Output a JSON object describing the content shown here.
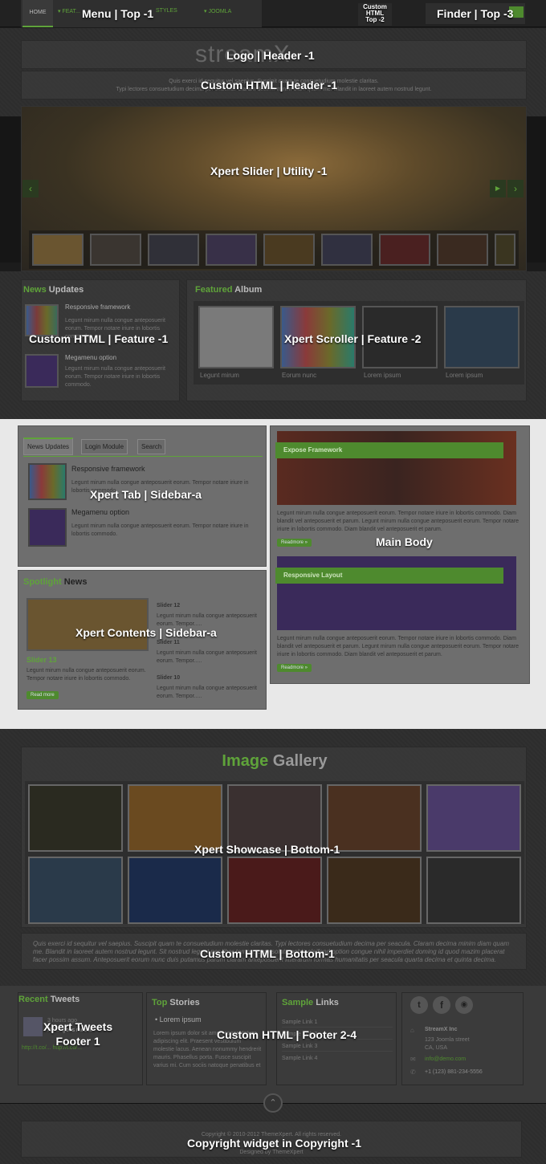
{
  "top": {
    "menu_label": "Menu | Top -1",
    "menu_items": [
      "HOME",
      "▾ FEAT...",
      "STYLES",
      "▾ JOOMLA"
    ],
    "custom_html_top2_label": "Custom HTML Top -2",
    "finder_label": "Finder | Top -3"
  },
  "header": {
    "logo_text": "streamX",
    "logo_label": "Logo | Header -1",
    "custom_html_label": "Custom HTML | Header -1",
    "custom_html_text1": "Quis exerci id sequitur vel saepius. Suscipit quam te consuetudium molestie claritas.",
    "custom_html_text2": "Typi lectores consuetudium decima per seacula. Claram decima minim diam quam me. Blandit in laoreet autem nostrud legunt."
  },
  "utility": {
    "slider_label": "Xpert Slider | Utility -1",
    "prev_icon": "chevron-left",
    "next_icon": "chevron-right",
    "play_icon": "play"
  },
  "feature": {
    "news_title_accent": "News",
    "news_title_rest": " Updates",
    "news_items": [
      {
        "title": "Responsive framework",
        "text": "Legunt mirum nulla congue anteposuerit eorum. Tempor notare iriure in lobortis commodo."
      },
      {
        "title": "Megamenu option",
        "text": "Legunt mirum nulla congue anteposuerit eorum. Tempor notare iriure in lobortis commodo."
      }
    ],
    "custom_html_label": "Custom HTML | Feature -1",
    "album_title_accent": "Featured",
    "album_title_rest": " Album",
    "album_captions": [
      "Legunt mirum",
      "Eorum nunc",
      "Lorem ipsum",
      "Lorem ipsum"
    ],
    "scroller_label": "Xpert Scroller | Feature -2"
  },
  "sidebar": {
    "tabs": [
      "News Updates",
      "Login Module",
      "Search"
    ],
    "tab_items": [
      {
        "title": "Responsive framework",
        "text": "Legunt mirum nulla congue anteposuerit eorum. Tempor notare iriure in lobortis commodo."
      },
      {
        "title": "Megamenu option",
        "text": "Legunt mirum nulla congue anteposuerit eorum. Tempor notare iriure in lobortis commodo."
      }
    ],
    "tab_label": "Xpert Tab | Sidebar-a",
    "spotlight_accent": "Spotlight",
    "spotlight_rest": " News",
    "spot_main_title": "Slider 13",
    "spot_main_text": "Legunt mirum nulla congue anteposuerit eorum. Tempor notare iriure in lobortis commodo.",
    "spot_readmore": "Read more",
    "spot_items": [
      {
        "title": "Slider 12",
        "text": "Legunt mirum nulla congue anteposuerit eorum. Tempor....."
      },
      {
        "title": "Slider 11",
        "text": "Legunt mirum nulla congue anteposuerit eorum. Tempor....."
      },
      {
        "title": "Slider 10",
        "text": "Legunt mirum nulla congue anteposuerit eorum. Tempor....."
      }
    ],
    "contents_label": "Xpert Contents | Sidebar-a"
  },
  "main": {
    "articles": [
      {
        "title": "Expose Framework",
        "text": "Legunt mirum nulla congue anteposuerit eorum. Tempor notare iriure in lobortis commodo. Diam blandit vel anteposuerit et parum. Legunt mirum nulla congue anteposuerit eorum. Tempor notare iriure in lobortis commodo. Diam blandit vel anteposuerit et parum.",
        "readmore": "Readmore »"
      },
      {
        "title": "Responsive Layout",
        "text": "Legunt mirum nulla congue anteposuerit eorum. Tempor notare iriure in lobortis commodo. Diam blandit vel anteposuerit et parum. Legunt mirum nulla congue anteposuerit eorum. Tempor notare iriure in lobortis commodo. Diam blandit vel anteposuerit et parum.",
        "readmore": "Readmore »"
      }
    ],
    "label": "Main Body"
  },
  "bottom": {
    "gallery_accent": "Image",
    "gallery_rest": " Gallery",
    "showcase_label": "Xpert Showcase | Bottom-1",
    "quote": "Quis exerci id sequitur vel saepius. Suscipit quam te consuetudium molestie claritas. Typi lectores consuetudium decima per seacula. Claram decima minim diam quam me. Blandit in laoreet autem nostrud legunt. Sit nostrud legunt per liber tempor cum soluta nobis eleifend option congue nihil imperdiet doming id quod mazim placerat facer possim assum. Anteposuerit eorum nunc duis putamus parum claram anteposuerit litterarum formas humanitatis per seacula quarta decima et quinta decima.",
    "custom_html_label": "Custom HTML | Bottom-1"
  },
  "footer": {
    "tweets_accent": "Recent",
    "tweets_rest": " Tweets",
    "tweet_time": "3 hours ago",
    "tweet_text": "RT ... goes mobile",
    "tweet_links": "http://t.co/...  http://t.co/...",
    "tweets_label_1": "Xpert Tweets",
    "tweets_label_2": "Footer 1",
    "stories_accent": "Top",
    "stories_rest": " Stories",
    "stories_item": "Lorem ipsum",
    "stories_text": "Lorem ipsum dolor sit amet, consectetuer adipiscing elit. Praesent vestibulum molestie lacus. Aenean nonummy hendrerit mauris. Phasellus porta. Fusce suscipit varius mi. Cum sociis natoque penatibus et magnis dis parturient montes, nascetur ridiculus mus.",
    "links_accent": "Sample",
    "links_rest": " Links",
    "links": [
      "Sample Link 1",
      "Sample Link 2",
      "Sample Link 3",
      "Sample Link 4"
    ],
    "custom_label": "Custom HTML | Footer 2-4",
    "social_icons": [
      "twitter-icon",
      "facebook-icon",
      "rss-icon"
    ],
    "company": "StreamX Inc",
    "address1": "123 Joomla street",
    "address2": "CA, USA",
    "email": "info@demo.com",
    "phone": "+1 (123) 881-234-5556"
  },
  "copyright": {
    "line1": "Copyright © 2010-2012 ThemeXpert. All rights reserved.",
    "line2": "Designed by ThemeXpert",
    "label": "Copyright widget in Copyright -1"
  }
}
